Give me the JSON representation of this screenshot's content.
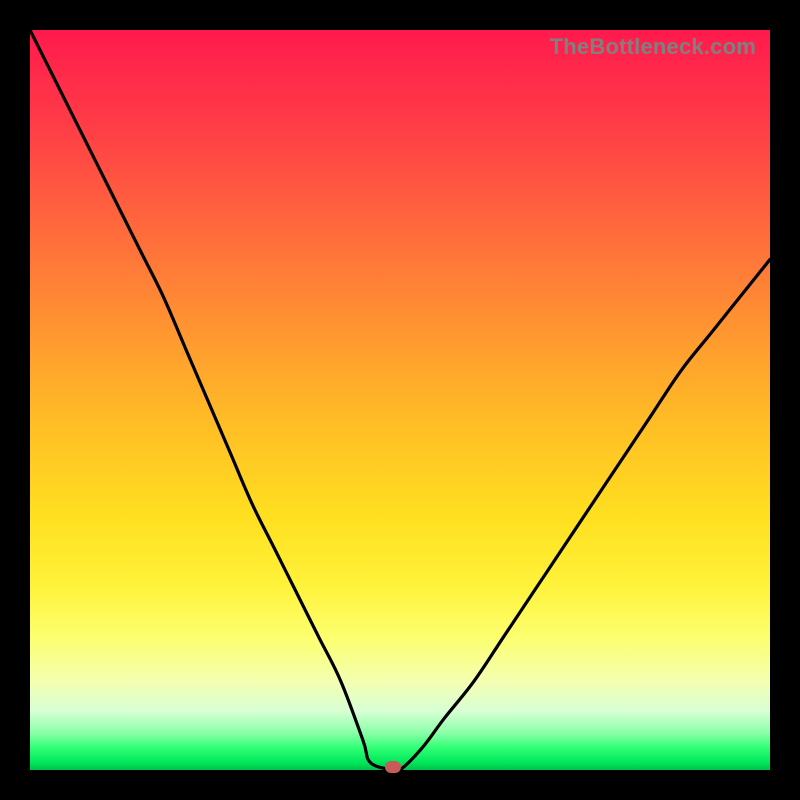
{
  "watermark": "TheBottleneck.com",
  "colors": {
    "frame": "#000000",
    "curve_stroke": "#000000",
    "marker_fill": "#c85a5a",
    "watermark_text": "#808080"
  },
  "chart_data": {
    "type": "line",
    "title": "",
    "xlabel": "",
    "ylabel": "",
    "xlim": [
      0,
      100
    ],
    "ylim": [
      0,
      100
    ],
    "grid": false,
    "legend": false,
    "series": [
      {
        "name": "bottleneck-curve",
        "x": [
          0,
          3,
          6,
          9,
          12,
          15,
          18,
          21,
          24,
          27,
          30,
          33,
          36,
          39,
          42,
          45,
          46,
          49,
          50,
          53,
          56,
          60,
          64,
          68,
          72,
          76,
          80,
          84,
          88,
          92,
          96,
          100
        ],
        "values": [
          100,
          94,
          88,
          82,
          76,
          70,
          64,
          57,
          50,
          43,
          36,
          30,
          24,
          18,
          12,
          4,
          1,
          0,
          0,
          3,
          7,
          12,
          18,
          24,
          30,
          36,
          42,
          48,
          54,
          59,
          64,
          69
        ]
      }
    ],
    "marker": {
      "x": 49,
      "y": 0
    },
    "background_gradient_stops": [
      {
        "pos": 0,
        "color": "#ff1a4d"
      },
      {
        "pos": 12,
        "color": "#ff3a47"
      },
      {
        "pos": 22,
        "color": "#ff5a40"
      },
      {
        "pos": 32,
        "color": "#ff7a38"
      },
      {
        "pos": 42,
        "color": "#ff9a2f"
      },
      {
        "pos": 52,
        "color": "#ffba26"
      },
      {
        "pos": 66,
        "color": "#ffe020"
      },
      {
        "pos": 75,
        "color": "#fff23a"
      },
      {
        "pos": 82,
        "color": "#fcff6e"
      },
      {
        "pos": 88,
        "color": "#f4ffb0"
      },
      {
        "pos": 92,
        "color": "#d8ffd4"
      },
      {
        "pos": 95,
        "color": "#8affa8"
      },
      {
        "pos": 97,
        "color": "#2fff74"
      },
      {
        "pos": 99,
        "color": "#00e65a"
      },
      {
        "pos": 100,
        "color": "#00c24b"
      }
    ]
  }
}
